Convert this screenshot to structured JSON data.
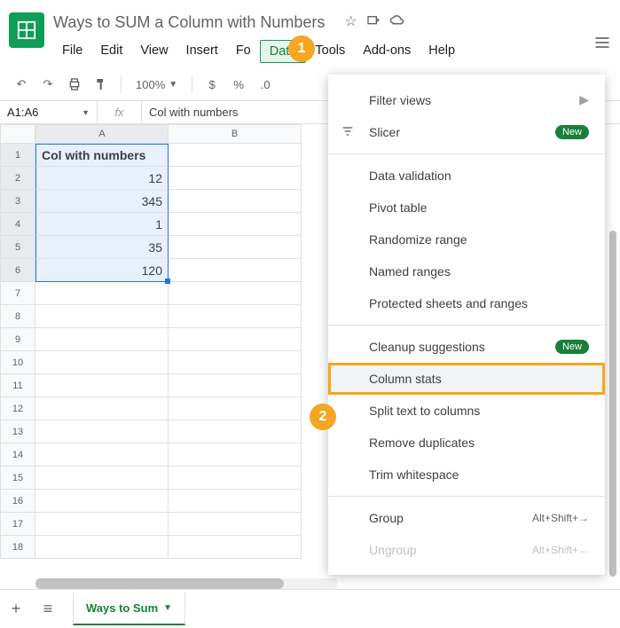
{
  "doc": {
    "title": "Ways to SUM a Column with Numbers"
  },
  "menubar": {
    "items": [
      "File",
      "Edit",
      "View",
      "Insert",
      "Fo",
      "Data",
      "Tools",
      "Add-ons",
      "Help"
    ],
    "active": 5
  },
  "toolbar": {
    "zoom": "100%",
    "currency": "$",
    "percent": "%",
    "dec": ".0"
  },
  "namebox": "A1:A6",
  "formula": "Col with numbers",
  "columns": [
    "A",
    "B"
  ],
  "rows": [
    1,
    2,
    3,
    4,
    5,
    6,
    7,
    8,
    9,
    10,
    11,
    12,
    13,
    14,
    15,
    16,
    17,
    18
  ],
  "cells": {
    "A1": "Col with numbers",
    "A2": "12",
    "A3": "345",
    "A4": "1",
    "A5": "35",
    "A6": "120"
  },
  "sheet": {
    "name": "Ways to Sum"
  },
  "menu": {
    "group1": [
      {
        "label": "Filter views",
        "arrow": true
      },
      {
        "label": "Slicer",
        "icon": "slicer",
        "badge": "New"
      }
    ],
    "group2": [
      {
        "label": "Data validation"
      },
      {
        "label": "Pivot table"
      },
      {
        "label": "Randomize range"
      },
      {
        "label": "Named ranges"
      },
      {
        "label": "Protected sheets and ranges"
      }
    ],
    "group3": [
      {
        "label": "Cleanup suggestions",
        "badge": "New"
      },
      {
        "label": "Column stats",
        "hl": true
      },
      {
        "label": "Split text to columns"
      },
      {
        "label": "Remove duplicates"
      },
      {
        "label": "Trim whitespace"
      }
    ],
    "group4": [
      {
        "label": "Group",
        "sc": "Alt+Shift+→"
      },
      {
        "label": "Ungroup",
        "sc": "Alt+Shift+←",
        "disabled": true
      }
    ]
  },
  "callouts": {
    "1": "1",
    "2": "2"
  }
}
